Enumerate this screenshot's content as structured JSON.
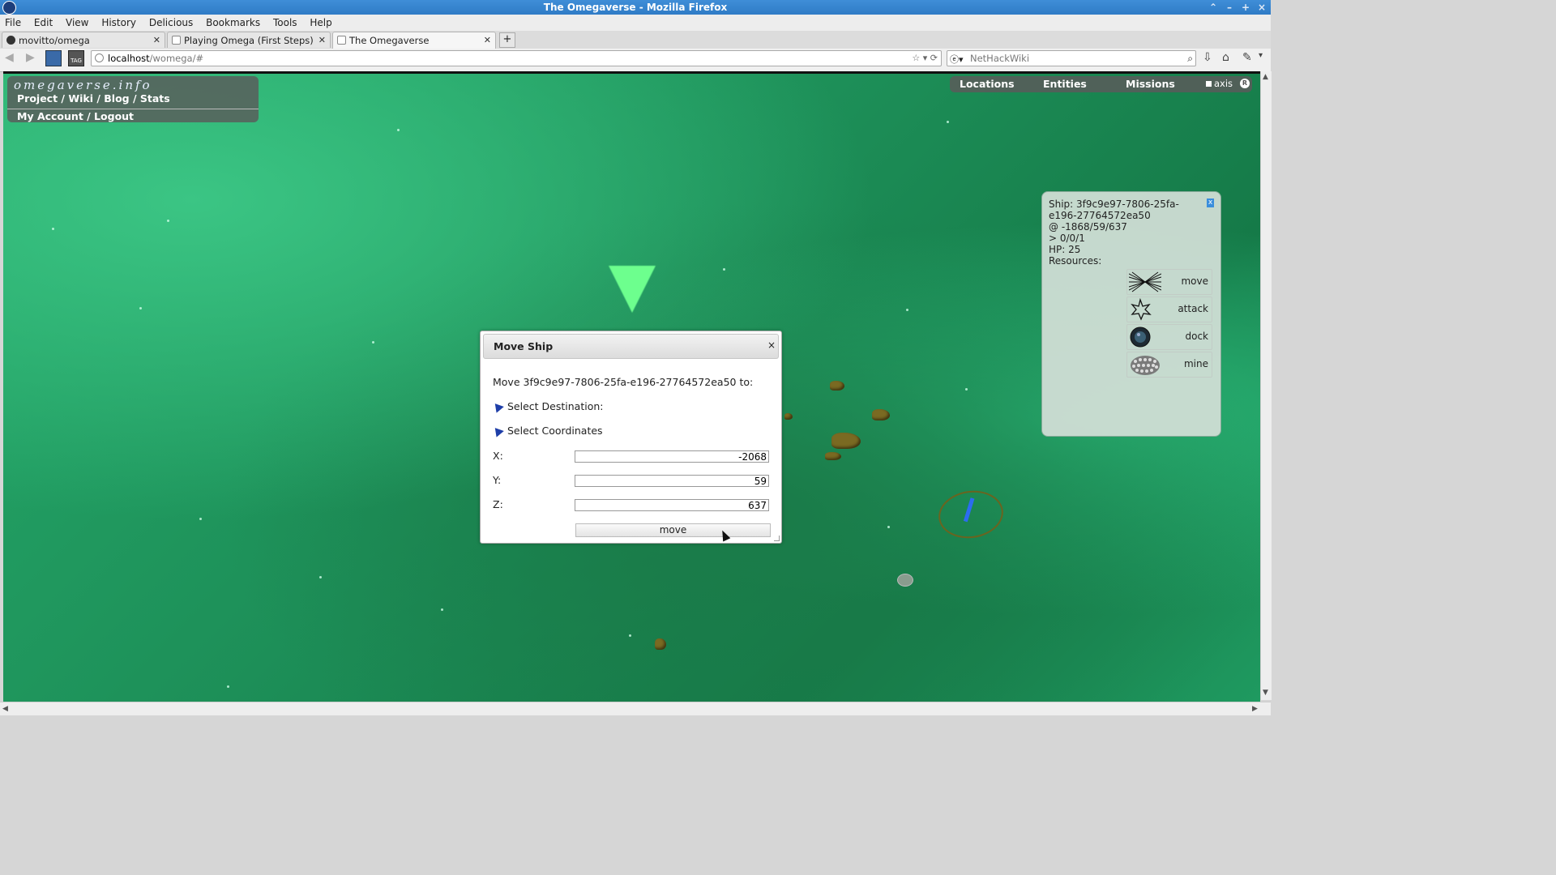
{
  "window": {
    "title": "The Omegaverse - Mozilla Firefox"
  },
  "menu": [
    "File",
    "Edit",
    "View",
    "History",
    "Delicious",
    "Bookmarks",
    "Tools",
    "Help"
  ],
  "tabs": [
    {
      "label": "movitto/omega"
    },
    {
      "label": "Playing Omega (First Steps)"
    },
    {
      "label": "The Omegaverse"
    }
  ],
  "address": {
    "host": "localhost",
    "path": "/womega/#"
  },
  "search": {
    "engine_icon": "search-engine-icon",
    "placeholder": "NetHackWiki"
  },
  "site": {
    "logo": "omegaverse.info",
    "links": "Project / Wiki / Blog / Stats",
    "account": "My Account / Logout"
  },
  "topmenu": {
    "locations": "Locations",
    "entities": "Entities",
    "missions": "Missions",
    "axis": "axis",
    "r": "R"
  },
  "ship_panel": {
    "close": "x",
    "line1": "Ship: 3f9c9e97-7806-25fa-",
    "line2": "e196-27764572ea50",
    "location": "@ -1868/59/637",
    "dir": "> 0/0/1",
    "hp": "HP: 25",
    "resources": "Resources:",
    "actions": [
      {
        "label": "move",
        "icon": "move-icon"
      },
      {
        "label": "attack",
        "icon": "attack-icon"
      },
      {
        "label": "dock",
        "icon": "dock-icon"
      },
      {
        "label": "mine",
        "icon": "mine-icon"
      }
    ]
  },
  "dialog": {
    "title": "Move Ship",
    "close": "×",
    "prompt": "Move 3f9c9e97-7806-25fa-e196-27764572ea50 to:",
    "select_destination": "Select Destination:",
    "select_coordinates": "Select Coordinates",
    "x_label": "X:",
    "y_label": "Y:",
    "z_label": "Z:",
    "x_value": "-2068",
    "y_value": "59",
    "z_value": "637",
    "move_button": "move"
  },
  "colors": {
    "space": "#1f9a60",
    "titlebar": "#3a88d4",
    "marker": "#6dff8e"
  }
}
